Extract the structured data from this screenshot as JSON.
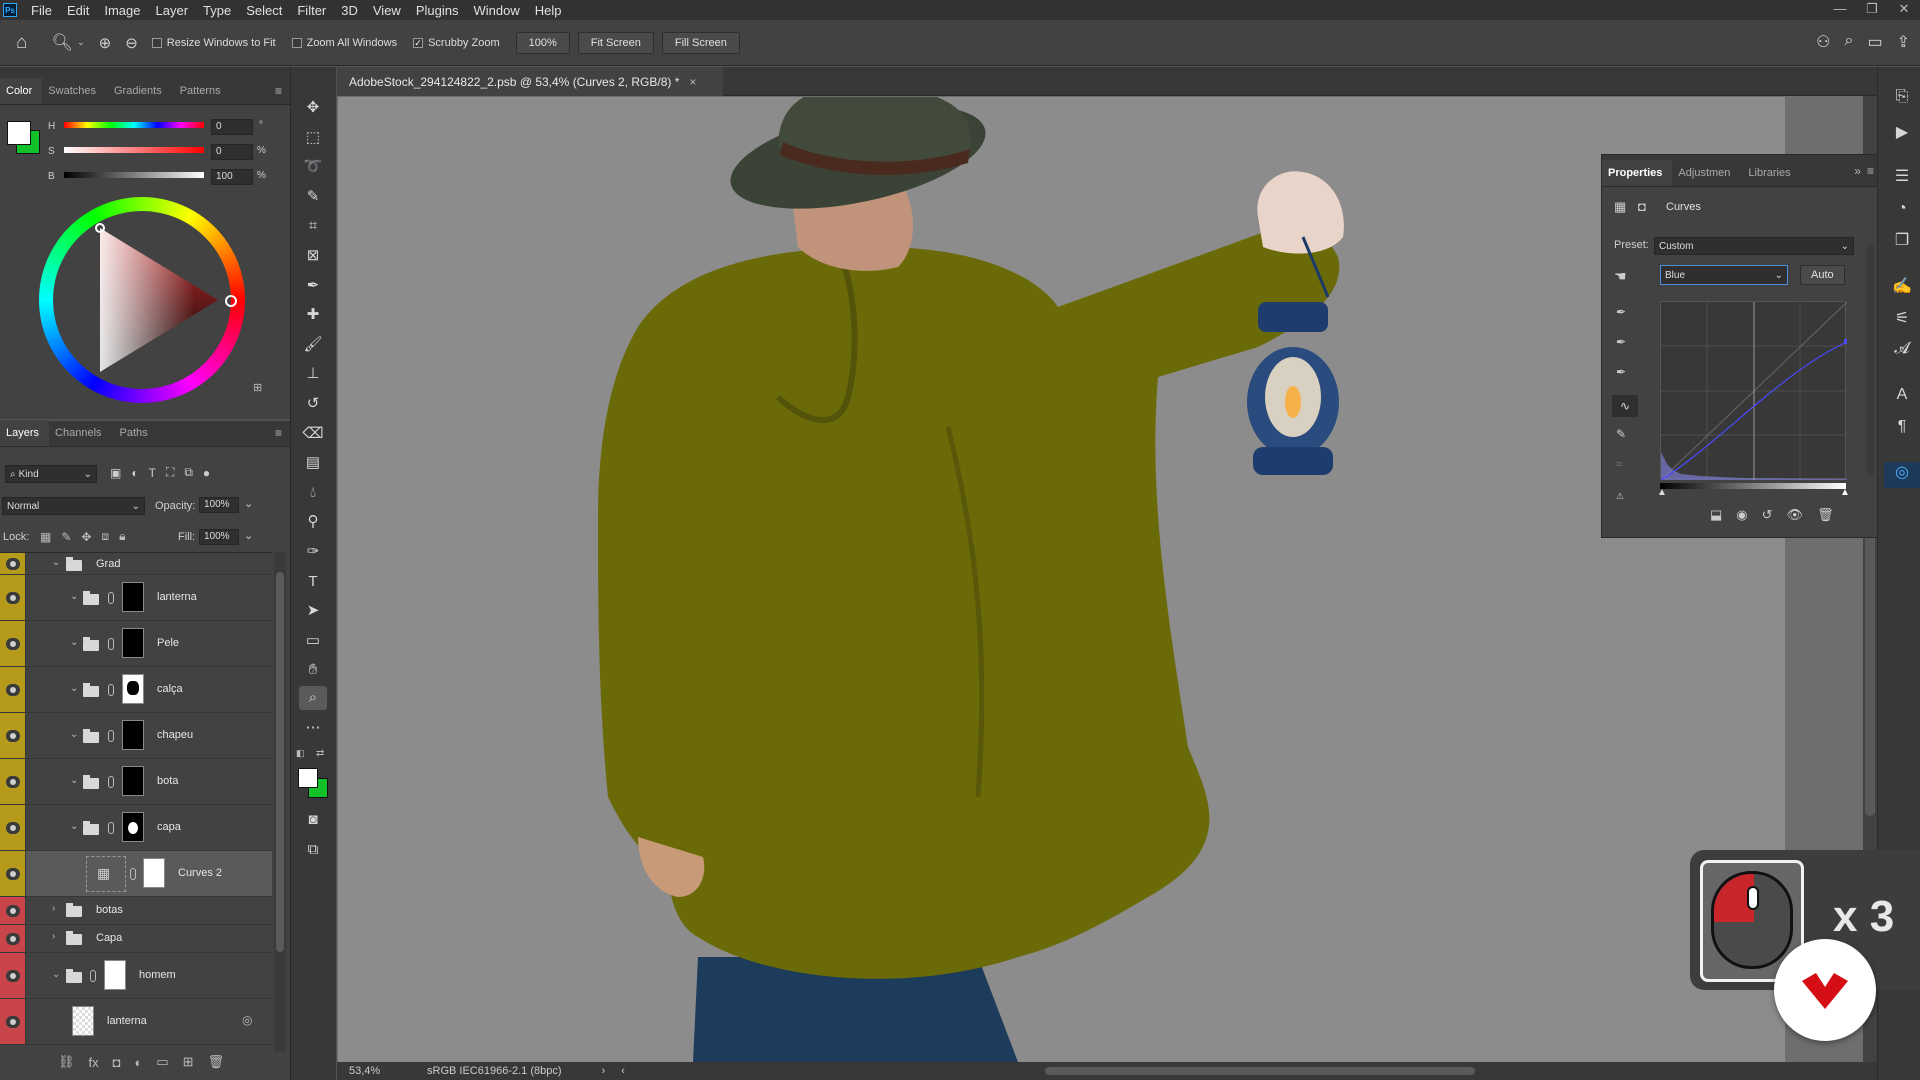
{
  "menu": {
    "app_badge": "Ps",
    "items": [
      "File",
      "Edit",
      "Image",
      "Layer",
      "Type",
      "Select",
      "Filter",
      "3D",
      "View",
      "Plugins",
      "Window",
      "Help"
    ]
  },
  "window_controls": [
    "—",
    "❐",
    "✕"
  ],
  "options": {
    "resize_windows": "Resize Windows to Fit",
    "zoom_all": "Zoom All Windows",
    "scrubby": "Scrubby Zoom",
    "zoom_value": "100%",
    "fit_screen": "Fit Screen",
    "fill_screen": "Fill Screen"
  },
  "color_panel": {
    "tabs": [
      "Color",
      "Swatches",
      "Gradients",
      "Patterns"
    ],
    "h_label": "H",
    "h_value": "0",
    "h_unit": "°",
    "s_label": "S",
    "s_value": "0",
    "s_unit": "%",
    "b_label": "B",
    "b_value": "100",
    "b_unit": "%"
  },
  "layers_panel": {
    "tabs": [
      "Layers",
      "Channels",
      "Paths"
    ],
    "filter_kind": "Kind",
    "blend_mode": "Normal",
    "opacity_label": "Opacity:",
    "opacity_value": "100%",
    "lock_label": "Lock:",
    "fill_label": "Fill:",
    "fill_value": "100%",
    "layers": [
      {
        "name": "Grad"
      },
      {
        "name": "lanterna"
      },
      {
        "name": "Pele"
      },
      {
        "name": "calça"
      },
      {
        "name": "chapeu"
      },
      {
        "name": "bota"
      },
      {
        "name": "capa"
      },
      {
        "name": "Curves 2"
      },
      {
        "name": "botas"
      },
      {
        "name": "Capa"
      },
      {
        "name": "homem"
      },
      {
        "name": "lanterna"
      }
    ],
    "bottom_icons": [
      "⛓",
      "fx",
      "◘",
      "◐",
      "▭",
      "⊞",
      "🗑"
    ]
  },
  "document": {
    "tab_title": "AdobeStock_294124822_2.psb @ 53,4% (Curves 2, RGB/8) *",
    "close": "×"
  },
  "properties_panel": {
    "tabs": [
      "Properties",
      "Adjustmen",
      "Libraries"
    ],
    "type": "Curves",
    "preset_label": "Preset:",
    "preset_value": "Custom",
    "channel_value": "Blue",
    "auto_button": "Auto"
  },
  "status": {
    "zoom": "53,4%",
    "profile": "sRGB IEC61966-2.1 (8bpc)"
  },
  "overlay": {
    "click_count": "x 3"
  },
  "colors": {
    "accent_yellow": "#b69a1b",
    "accent_red": "#c8464a",
    "canvas": "#8c8c8c",
    "jacket": "#6b6a08",
    "brand_red": "#d40e14"
  }
}
